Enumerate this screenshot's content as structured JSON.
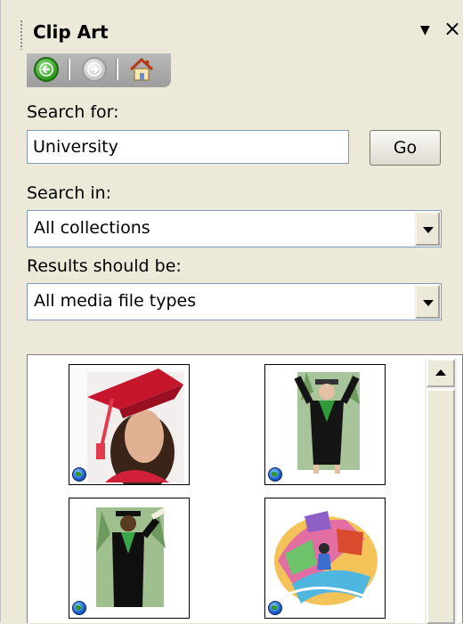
{
  "panel": {
    "title": "Clip Art",
    "menu_icon": "chevron-down-icon",
    "close_glyph": "×"
  },
  "nav": {
    "back_icon": "back-arrow-icon",
    "forward_icon": "forward-arrow-icon",
    "home_icon": "home-icon"
  },
  "search": {
    "label": "Search for:",
    "value": "University",
    "go_label": "Go"
  },
  "search_in": {
    "label": "Search in:",
    "selected": "All collections"
  },
  "results_type": {
    "label": "Results should be:",
    "selected": "All media file types"
  },
  "results": {
    "items": [
      {
        "name": "graduate-woman-cap",
        "badge_icon": "globe-icon"
      },
      {
        "name": "graduate-gown-figure",
        "badge_icon": "globe-icon"
      },
      {
        "name": "graduate-diploma-figure",
        "badge_icon": "globe-icon"
      },
      {
        "name": "colorful-campus-illustration",
        "badge_icon": "globe-icon"
      }
    ]
  },
  "colors": {
    "panel_bg": "#ece9d8",
    "nav_bg": "#a9a9a9",
    "back_button": "#2f9a1f",
    "field_border": "#7f9db9"
  }
}
